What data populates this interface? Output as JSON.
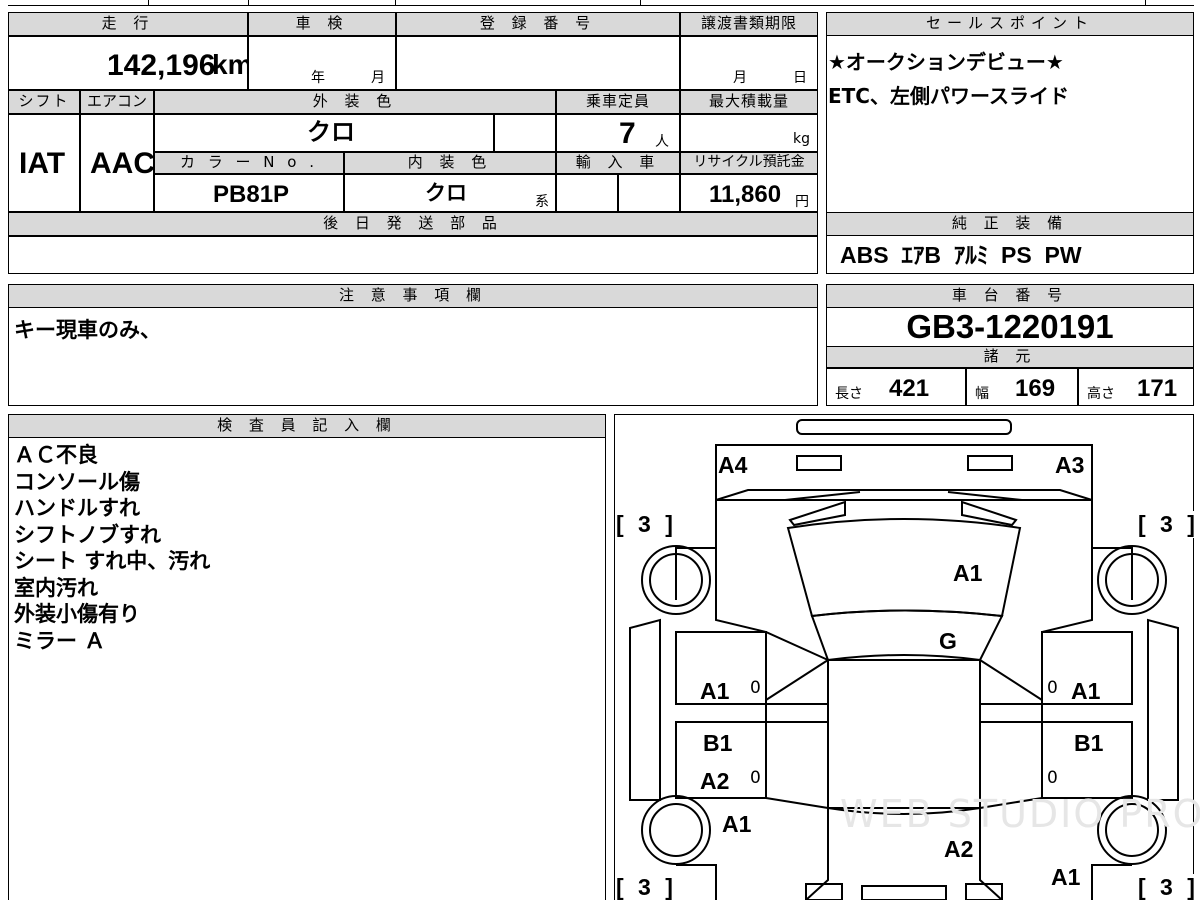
{
  "header": {
    "mileage_label": "走 行",
    "inspection_label": "車 検",
    "reg_number_label": "登 録 番 号",
    "transfer_deadline_label": "譲渡書類期限",
    "sales_point_label": "セールスポイント"
  },
  "values": {
    "mileage": "142,196",
    "mileage_unit": "km",
    "inspection_year_unit": "年",
    "inspection_month_unit": "月",
    "transfer_month_unit": "月",
    "transfer_day_unit": "日"
  },
  "labels2": {
    "shift": "シフト",
    "aircon": "エアコン",
    "exterior_color": "外 装 色",
    "capacity": "乗車定員",
    "max_load": "最大積載量",
    "color_no": "カ ラ ー N o .",
    "interior_color": "内 装 色",
    "imported": "輸 入 車",
    "recycle_fee": "リサイクル預託金"
  },
  "values2": {
    "shift": "IAT",
    "aircon": "AAC",
    "exterior_color": "クロ",
    "capacity": "7",
    "capacity_unit": "人",
    "max_load_unit": "kg",
    "color_no": "PB81P",
    "interior_color": "クロ",
    "interior_suffix": "系",
    "recycle_fee": "11,860",
    "recycle_unit": "円"
  },
  "sales_points": {
    "line1": "★オークションデビュー★",
    "line2": "ETC、左側パワースライド"
  },
  "later_parts": {
    "label": "後 日 発 送 部 品",
    "value": ""
  },
  "standard_equipment": {
    "label": "純 正 装 備",
    "value": "ABS  ｴｱB  ｱﾙﾐ  PS  PW"
  },
  "notes": {
    "label": "注 意 事 項 欄",
    "value": "キー現車のみ、"
  },
  "chassis": {
    "label": "車 台 番 号",
    "value": "GB3-1220191",
    "spec_label": "諸 元",
    "length_label": "長さ",
    "length": "421",
    "width_label": "幅",
    "width": "169",
    "height_label": "高さ",
    "height": "171"
  },
  "inspector": {
    "label": "検 査 員 記 入 欄",
    "text": "ＡＣ不良\nコンソール傷\nハンドルすれ\nシフトノブすれ\nシート すれ中、汚れ\n室内汚れ\n外装小傷有り\nミラー Ａ"
  },
  "damage_map": {
    "watermark": "WEB STUDIO PRO",
    "tire": "[ 3 ]",
    "marks": {
      "front_left": "A4",
      "front_right": "A3",
      "bonnet": "A1",
      "windshield": "G",
      "left_front_fender": "A1",
      "left_front_door": "B1",
      "left_rear_door": "A2",
      "left_rear": "A1",
      "right_front_fender": "A1",
      "right_front_door": "B1",
      "right_rear_bottom": "A1",
      "roof_rear": "A2",
      "zero": "0"
    }
  }
}
